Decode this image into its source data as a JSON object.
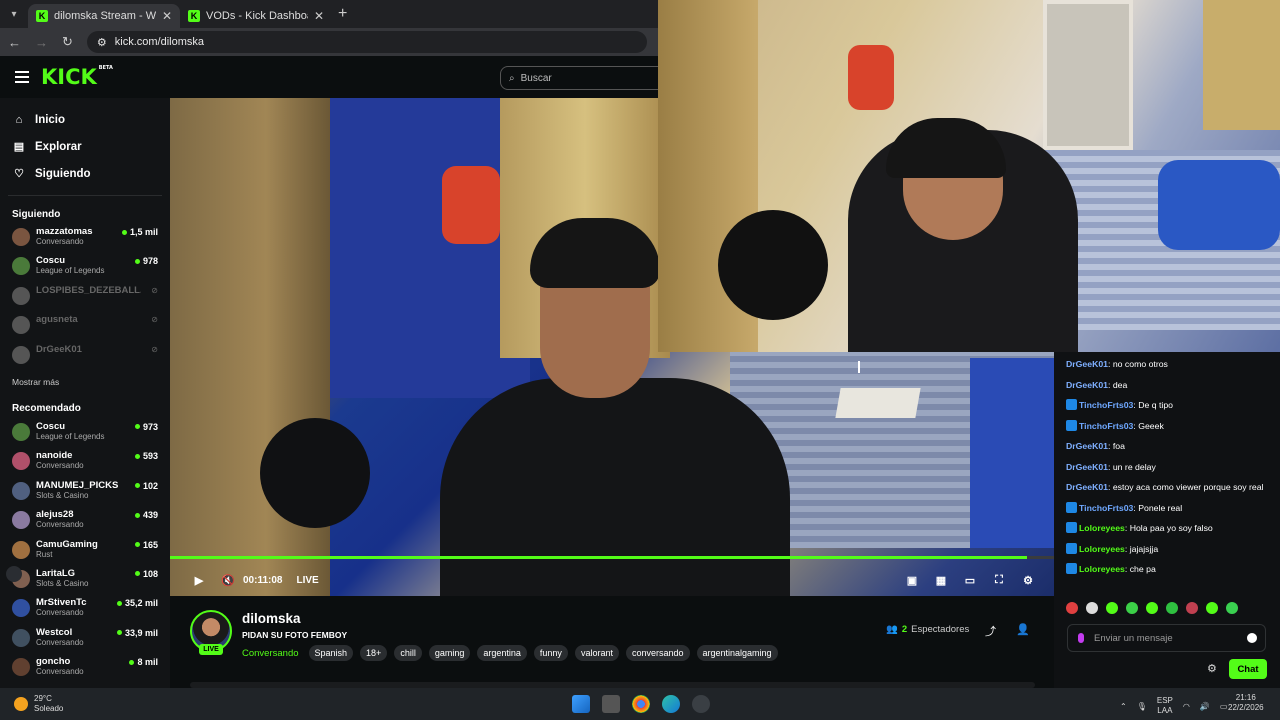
{
  "browser": {
    "tabs": [
      {
        "title": "dilomska Stream - Watch Live o",
        "favicon": "K",
        "active": true
      },
      {
        "title": "VODs - Kick Dashboard",
        "favicon": "K",
        "active": false
      }
    ],
    "url": "kick.com/dilomska"
  },
  "header": {
    "logo": "KICK",
    "logo_sup": "BETA",
    "search_placeholder": "Buscar"
  },
  "nav": [
    {
      "label": "Inicio",
      "icon": "home-icon"
    },
    {
      "label": "Explorar",
      "icon": "browse-icon"
    },
    {
      "label": "Siguiendo",
      "icon": "heart-icon"
    }
  ],
  "following": {
    "title": "Siguiendo",
    "channels": [
      {
        "name": "mazzatomas",
        "category": "Conversando",
        "viewers": "1,5 mil",
        "live": true,
        "color": "#7a5540"
      },
      {
        "name": "Coscu",
        "category": "League of Legends",
        "viewers": "978",
        "live": true,
        "color": "#4a7a3a"
      },
      {
        "name": "LOSPIBES_DEZEBALL...",
        "category": "",
        "viewers": "",
        "live": false,
        "color": "#555"
      },
      {
        "name": "agusneta",
        "category": "",
        "viewers": "",
        "live": false,
        "color": "#555"
      },
      {
        "name": "DrGeeK01",
        "category": "",
        "viewers": "",
        "live": false,
        "color": "#555"
      }
    ],
    "more": "Mostrar más"
  },
  "recommended": {
    "title": "Recomendado",
    "channels": [
      {
        "name": "Coscu",
        "category": "League of Legends",
        "viewers": "973",
        "color": "#4a7a3a"
      },
      {
        "name": "nanoide",
        "category": "Conversando",
        "viewers": "593",
        "color": "#b0506a"
      },
      {
        "name": "MANUMEJ_PICKS",
        "category": "Slots & Casino",
        "viewers": "102",
        "color": "#506080"
      },
      {
        "name": "alejus28",
        "category": "Conversando",
        "viewers": "439",
        "color": "#8a7aa0"
      },
      {
        "name": "CamuGaming",
        "category": "Rust",
        "viewers": "165",
        "color": "#a07040"
      },
      {
        "name": "LaritaLG",
        "category": "Slots & Casino",
        "viewers": "108",
        "color": "#806050"
      },
      {
        "name": "MrStivenTc",
        "category": "Conversando",
        "viewers": "35,2 mil",
        "color": "#3050a0"
      },
      {
        "name": "Westcol",
        "category": "Conversando",
        "viewers": "33,9 mil",
        "color": "#405060"
      },
      {
        "name": "goncho",
        "category": "Conversando",
        "viewers": "8 mil",
        "color": "#604030"
      }
    ]
  },
  "player": {
    "time": "00:11:08",
    "live_label": "LIVE",
    "progress": 0.97
  },
  "stream": {
    "username": "dilomska",
    "title": "PIDAN SU FOTO FEMBOY",
    "category": "Conversando",
    "live_badge": "LIVE",
    "tags": [
      "Spanish",
      "18+",
      "chill",
      "gaming",
      "argentina",
      "funny",
      "valorant",
      "conversando",
      "argentinalgaming"
    ],
    "viewers_count": "2",
    "viewers_label": "Espectadores"
  },
  "chat": {
    "messages": [
      {
        "user": "DrGeeK01",
        "text": "no como otros",
        "color": "#7fb0ff",
        "badge": false
      },
      {
        "user": "DrGeeK01",
        "text": "dea",
        "color": "#7fb0ff",
        "badge": false
      },
      {
        "user": "TinchoFrts03",
        "text": "De q tipo",
        "color": "#6fa8ff",
        "badge": true
      },
      {
        "user": "TinchoFrts03",
        "text": "Geeek",
        "color": "#6fa8ff",
        "badge": true
      },
      {
        "user": "DrGeeK01",
        "text": "foa",
        "color": "#7fb0ff",
        "badge": false
      },
      {
        "user": "DrGeeK01",
        "text": "un re delay",
        "color": "#7fb0ff",
        "badge": false
      },
      {
        "user": "DrGeeK01",
        "text": "estoy aca como viewer porque soy real",
        "color": "#7fb0ff",
        "badge": false
      },
      {
        "user": "TinchoFrts03",
        "text": "Ponele real",
        "color": "#6fa8ff",
        "badge": true
      },
      {
        "user": "Loloreyees",
        "text": "Hola paa yo soy falso",
        "color": "#53fc18",
        "badge": true
      },
      {
        "user": "Loloreyees",
        "text": "jajajsjja",
        "color": "#53fc18",
        "badge": true
      },
      {
        "user": "Loloreyees",
        "text": "che pa",
        "color": "#53fc18",
        "badge": true
      }
    ],
    "input_placeholder": "Enviar un mensaje",
    "send_label": "Chat"
  },
  "taskbar": {
    "temp": "29°C",
    "weather": "Soleado",
    "lang1": "ESP",
    "lang2": "LAA",
    "time": "21:16",
    "date": "22/2/2026"
  },
  "colors": {
    "accent": "#53fc18",
    "bg": "#0b0e0f",
    "sidebar": "#121416"
  }
}
